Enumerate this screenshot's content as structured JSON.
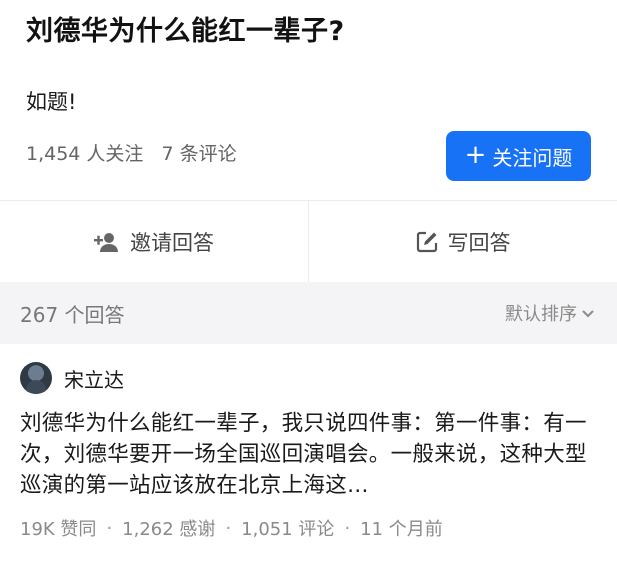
{
  "question": {
    "title": "刘德华为什么能红一辈子?",
    "detail": "如题!",
    "followers": "1,454 人关注",
    "comments": "7 条评论",
    "follow_button": "关注问题"
  },
  "actions": {
    "invite": "邀请回答",
    "write": "写回答"
  },
  "answers_header": {
    "count": "267 个回答",
    "sort": "默认排序"
  },
  "answer": {
    "author": "宋立达",
    "excerpt": "刘德华为什么能红一辈子，我只说四件事：第一件事：有一次，刘德华要开一场全国巡回演唱会。一般来说，这种大型巡演的第一站应该放在北京上海这…",
    "stats": {
      "likes": "19K 赞同",
      "thanks": "1,262 感谢",
      "comments": "1,051 评论",
      "time": "11 个月前"
    }
  },
  "colors": {
    "accent": "#1772f6",
    "muted": "#8a8a8a",
    "header_bg": "#f4f4f6"
  },
  "icons": {
    "invite": "add-user-icon",
    "write": "edit-icon",
    "sort": "chevron-down-icon",
    "follow": "plus-icon"
  }
}
